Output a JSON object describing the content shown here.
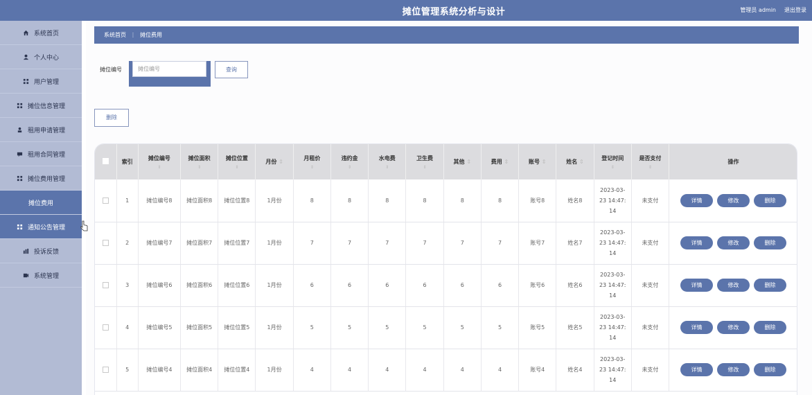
{
  "header": {
    "title": "摊位管理系统分析与设计",
    "user": "管理员 admin",
    "logout": "退出登录"
  },
  "sidebar": {
    "items": [
      {
        "label": "系统首页",
        "icon": "home-icon"
      },
      {
        "label": "个人中心",
        "icon": "user-icon"
      },
      {
        "label": "用户管理",
        "icon": "grid-icon"
      },
      {
        "label": "摊位信息管理",
        "icon": "grid-icon"
      },
      {
        "label": "租用申请管理",
        "icon": "person-icon"
      },
      {
        "label": "租用合同管理",
        "icon": "chat-icon"
      },
      {
        "label": "摊位费用管理",
        "icon": "grid-icon"
      },
      {
        "label": "摊位费用",
        "icon": ""
      },
      {
        "label": "通知公告管理",
        "icon": "grid-icon"
      },
      {
        "label": "投诉反馈",
        "icon": "chart-icon"
      },
      {
        "label": "系统管理",
        "icon": "video-icon"
      }
    ]
  },
  "breadcrumb": {
    "home": "系统首页",
    "sep": "⋮",
    "current": "摊位费用"
  },
  "search": {
    "label": "摊位编号",
    "placeholder": "摊位编号",
    "button": "查询"
  },
  "toolbar": {
    "delete": "删除"
  },
  "table": {
    "headers": [
      "索引",
      "摊位编号",
      "摊位面积",
      "摊位位置",
      "月份",
      "月租价",
      "违约金",
      "水电费",
      "卫生费",
      "其他",
      "费用",
      "账号",
      "姓名",
      "登记时间",
      "是否支付",
      "操作"
    ],
    "rows": [
      {
        "index": "1",
        "code": "摊位编号8",
        "area": "摊位面积8",
        "location": "摊位位置8",
        "month": "1月份",
        "rent": "8",
        "penalty": "8",
        "utility": "8",
        "hygiene": "8",
        "other": "8",
        "fee": "8",
        "account": "账号8",
        "name": "姓名8",
        "time1": "2023-03-",
        "time2": "23 14:47:",
        "time3": "14",
        "paid": "未支付"
      },
      {
        "index": "2",
        "code": "摊位编号7",
        "area": "摊位面积7",
        "location": "摊位位置7",
        "month": "1月份",
        "rent": "7",
        "penalty": "7",
        "utility": "7",
        "hygiene": "7",
        "other": "7",
        "fee": "7",
        "account": "账号7",
        "name": "姓名7",
        "time1": "2023-03-",
        "time2": "23 14:47:",
        "time3": "14",
        "paid": "未支付"
      },
      {
        "index": "3",
        "code": "摊位编号6",
        "area": "摊位面积6",
        "location": "摊位位置6",
        "month": "1月份",
        "rent": "6",
        "penalty": "6",
        "utility": "6",
        "hygiene": "6",
        "other": "6",
        "fee": "6",
        "account": "账号6",
        "name": "姓名6",
        "time1": "2023-03-",
        "time2": "23 14:47:",
        "time3": "14",
        "paid": "未支付"
      },
      {
        "index": "4",
        "code": "摊位编号5",
        "area": "摊位面积5",
        "location": "摊位位置5",
        "month": "1月份",
        "rent": "5",
        "penalty": "5",
        "utility": "5",
        "hygiene": "5",
        "other": "5",
        "fee": "5",
        "account": "账号5",
        "name": "姓名5",
        "time1": "2023-03-",
        "time2": "23 14:47:",
        "time3": "14",
        "paid": "未支付"
      },
      {
        "index": "5",
        "code": "摊位编号4",
        "area": "摊位面积4",
        "location": "摊位位置4",
        "month": "1月份",
        "rent": "4",
        "penalty": "4",
        "utility": "4",
        "hygiene": "4",
        "other": "4",
        "fee": "4",
        "account": "账号4",
        "name": "姓名4",
        "time1": "2023-03-",
        "time2": "23 14:47:",
        "time3": "14",
        "paid": "未支付"
      }
    ],
    "actions": {
      "detail": "详情",
      "edit": "修改",
      "delete": "删除"
    }
  },
  "colors": {
    "primary": "#5b74ab",
    "sidebar": "#b2bbd4",
    "header_row": "#dcdcdf"
  }
}
